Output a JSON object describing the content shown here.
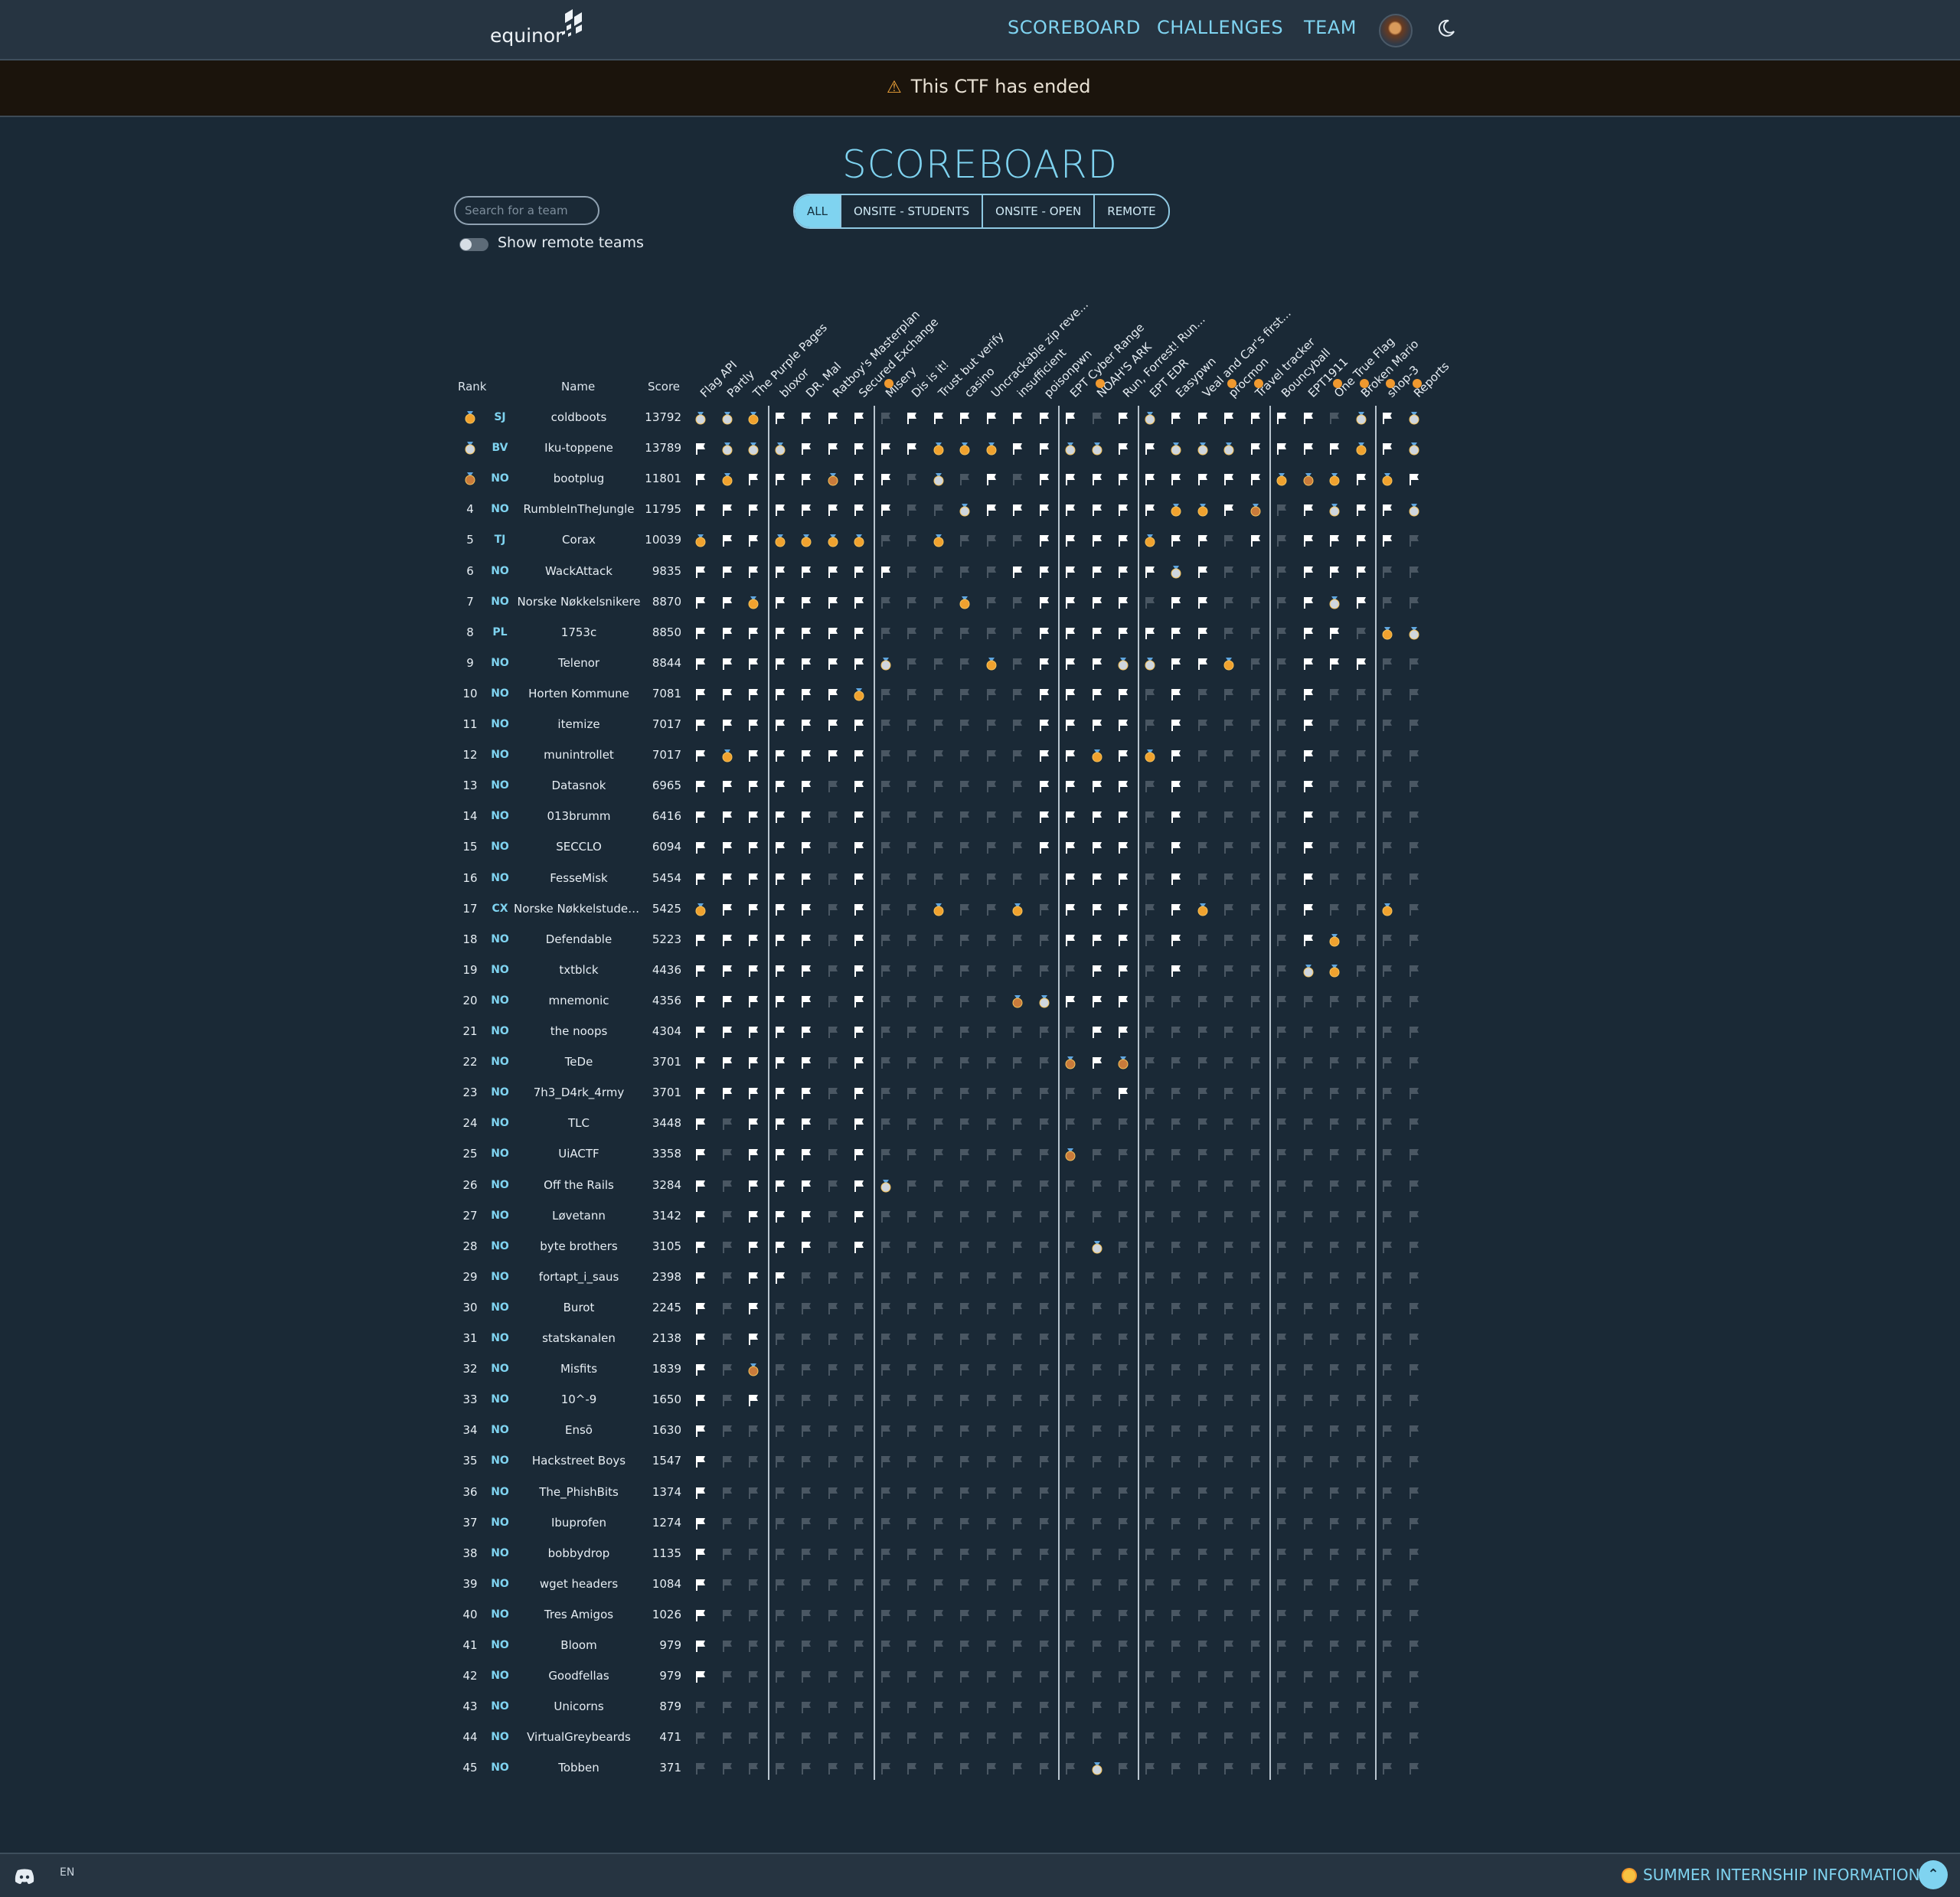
{
  "brand": {
    "name": "equinor"
  },
  "nav": {
    "scoreboard": "SCOREBOARD",
    "challenges": "CHALLENGES",
    "team": "TEAM"
  },
  "banner": {
    "text": "This CTF has ended"
  },
  "page": {
    "title": "SCOREBOARD"
  },
  "search": {
    "placeholder": "Search for a team"
  },
  "toggle": {
    "label": "Show remote teams",
    "on": false
  },
  "filters": [
    "ALL",
    "ONSITE - STUDENTS",
    "ONSITE - OPEN",
    "REMOTE"
  ],
  "active_filter": "ALL",
  "table": {
    "headers": {
      "rank": "Rank",
      "name": "Name",
      "score": "Score"
    },
    "challenges": [
      "Flag API",
      "Partly",
      "The Purple Pages",
      "bloxor",
      "DR. Mal",
      "Ratboy's Masterplan",
      "Secured Exchange",
      "Misery",
      "Dis is it!",
      "Trust but verify",
      "casino",
      "Uncrackable zip reve...",
      "insufficient",
      "poisonpwn",
      "EPT Cyber Range",
      "NOAH'S ARK",
      "Run, Forrest! Run...",
      "EPT EDR",
      "Easypwn",
      "Veal and Car's first...",
      "procmon",
      "Travel tracker",
      "Bouncyball",
      "EPT1911",
      "One True Flag",
      "Broken Mario",
      "shop-3",
      "Reports"
    ],
    "challenge_highlight": [
      false,
      false,
      false,
      false,
      false,
      false,
      false,
      true,
      false,
      false,
      false,
      false,
      false,
      false,
      false,
      true,
      false,
      false,
      false,
      false,
      true,
      true,
      false,
      false,
      true,
      true,
      true,
      true
    ],
    "rows": [
      {
        "rank": "1",
        "medal": "gold",
        "cc": "SJ",
        "name": "coldboots",
        "score": "13792",
        "solves": "ssgzfffnfffffffnfsffffffnsfs"
      },
      {
        "rank": "2",
        "medal": "silver",
        "cc": "BV",
        "name": "Iku-toppene",
        "score": "13789",
        "solves": "fsssfffffgggffssffsssffffgfs"
      },
      {
        "rank": "3",
        "medal": "bronze",
        "cc": "NO",
        "name": "bootplug",
        "score": "11801",
        "solves": "fgfffbfffsnfnfffffffffgbgfgf"
      },
      {
        "rank": "4",
        "cc": "NO",
        "name": "RumbleInTheJungle",
        "score": "11795",
        "solves": "ffffffffffsfffffffggfbffsffs"
      },
      {
        "rank": "5",
        "cc": "TJ",
        "name": "Corax",
        "score": "10039",
        "solves": "gffggggffgfffffffgffffffffff"
      },
      {
        "rank": "6",
        "cc": "NO",
        "name": "WackAttack",
        "score": "9835",
        "solves": "ffffffffffffffffffsfffffffff"
      },
      {
        "rank": "7",
        "cc": "NO",
        "name": "Norske Nøkkelsnikere",
        "score": "8870",
        "solves": "ffgfffffffgfffffffffffffsfff"
      },
      {
        "rank": "8",
        "cc": "PL",
        "name": "1753c",
        "score": "8850",
        "solves": "ffffffffffffffffffffffffffgs"
      },
      {
        "rank": "9",
        "cc": "NO",
        "name": "Telenor",
        "score": "8844",
        "solves": "fffffffsfffgffffssffgfffffff"
      },
      {
        "rank": "10",
        "cc": "NO",
        "name": "Horten Kommune",
        "score": "7081",
        "solves": "ffffffgfffffffffffffffffffff"
      },
      {
        "rank": "11",
        "cc": "NO",
        "name": "itemize",
        "score": "7017",
        "solves": "ffffffffffffffffffffffffffff"
      },
      {
        "rank": "12",
        "cc": "NO",
        "name": "munintrollet",
        "score": "7017",
        "solves": "fgfffffffffffffgfgffffffffff"
      },
      {
        "rank": "13",
        "cc": "NO",
        "name": "Datasnok",
        "score": "6965",
        "solves": "ffffffffffffffffffffffffffff"
      },
      {
        "rank": "14",
        "cc": "NO",
        "name": "013brumm",
        "score": "6416",
        "solves": "ffffffffffffffffffffffffffff"
      },
      {
        "rank": "15",
        "cc": "NO",
        "name": "SECCLO",
        "score": "6094",
        "solves": "ffffffffffffffffffffffffffff"
      },
      {
        "rank": "16",
        "cc": "NO",
        "name": "FesseMisk",
        "score": "5454",
        "solves": "ffffffffffffffffffffffffffff"
      },
      {
        "rank": "17",
        "cc": "CX",
        "name": "Norske Nøkkelstudent...",
        "score": "5425",
        "solves": "gffffffffgffgffffffgffffffgf"
      },
      {
        "rank": "18",
        "cc": "NO",
        "name": "Defendable",
        "score": "5223",
        "solves": "ffffffffffffffffffffffffgfff"
      },
      {
        "rank": "19",
        "cc": "NO",
        "name": "txtblck",
        "score": "4436",
        "solves": "fffffffffffffffffffffffsgfff"
      },
      {
        "rank": "20",
        "cc": "NO",
        "name": "mnemonic",
        "score": "4356",
        "solves": "ffffffffffffbsffffffffffffff"
      },
      {
        "rank": "21",
        "cc": "NO",
        "name": "the noops",
        "score": "4304",
        "solves": "ffffffffffffffffffffffffffff"
      },
      {
        "rank": "22",
        "cc": "NO",
        "name": "TeDe",
        "score": "3701",
        "solves": "ffffffffffffffbfbfffffffffff"
      },
      {
        "rank": "23",
        "cc": "NO",
        "name": "7h3_D4rk_4rmy",
        "score": "3701",
        "solves": "ffffffffffffffffffffffffffff"
      },
      {
        "rank": "24",
        "cc": "NO",
        "name": "TLC",
        "score": "3448",
        "solves": "ffffffffffffffffffffffffffff"
      },
      {
        "rank": "25",
        "cc": "NO",
        "name": "UiACTF",
        "score": "3358",
        "solves": "ffffffffffffffbfffffffffffff"
      },
      {
        "rank": "26",
        "cc": "NO",
        "name": "Off the Rails",
        "score": "3284",
        "solves": "fffffffsffffffffffffffffffff"
      },
      {
        "rank": "27",
        "cc": "NO",
        "name": "Løvetann",
        "score": "3142",
        "solves": "ffffffffffffffffffffffffffff"
      },
      {
        "rank": "28",
        "cc": "NO",
        "name": "byte brothers",
        "score": "3105",
        "solves": "fffffffffffffffsffffffffffff"
      },
      {
        "rank": "29",
        "cc": "NO",
        "name": "fortapt_i_saus",
        "score": "2398",
        "solves": "ffffffffffffffffffffffffffff"
      },
      {
        "rank": "30",
        "cc": "NO",
        "name": "Burot",
        "score": "2245",
        "solves": "ffffffffffffffffffffffffffff"
      },
      {
        "rank": "31",
        "cc": "NO",
        "name": "statskanalen",
        "score": "2138",
        "solves": "ffffffffffffffffffffffffffff"
      },
      {
        "rank": "32",
        "cc": "NO",
        "name": "Misfits",
        "score": "1839",
        "solves": "ffbfffffffffffffffffffffffff"
      },
      {
        "rank": "33",
        "cc": "NO",
        "name": "10^-9",
        "score": "1650",
        "solves": "ffffffffffffffffffffffffffff"
      },
      {
        "rank": "34",
        "cc": "NO",
        "name": "Ensō",
        "score": "1630",
        "solves": "ffffffffffffffffffffffffffff"
      },
      {
        "rank": "35",
        "cc": "NO",
        "name": "Hackstreet Boys",
        "score": "1547",
        "solves": "ffffffffffffffffffffffffffff"
      },
      {
        "rank": "36",
        "cc": "NO",
        "name": "The_PhishBits",
        "score": "1374",
        "solves": "ffffffffffffffffffffffffffff"
      },
      {
        "rank": "37",
        "cc": "NO",
        "name": "Ibuprofen",
        "score": "1274",
        "solves": "ffffffffffffffffffffffffffff"
      },
      {
        "rank": "38",
        "cc": "NO",
        "name": "bobbydrop",
        "score": "1135",
        "solves": "ffffffffffffffffffffffffffff"
      },
      {
        "rank": "39",
        "cc": "NO",
        "name": "wget headers",
        "score": "1084",
        "solves": "ffffffffffffffffffffffffffff"
      },
      {
        "rank": "40",
        "cc": "NO",
        "name": "Tres Amigos",
        "score": "1026",
        "solves": "ffffffffffffffffffffffffffff"
      },
      {
        "rank": "41",
        "cc": "NO",
        "name": "Bloom",
        "score": "979",
        "solves": "ffffffffffffffffffffffffffff"
      },
      {
        "rank": "42",
        "cc": "NO",
        "name": "Goodfellas",
        "score": "979",
        "solves": "ffffffffffffffffffffffffffff"
      },
      {
        "rank": "43",
        "cc": "NO",
        "name": "Unicorns",
        "score": "879",
        "solves": "ffffffffffffffffffffffffffff"
      },
      {
        "rank": "44",
        "cc": "NO",
        "name": "VirtualGreybeards",
        "score": "471",
        "solves": "ffffffffffffffffffffffffffff"
      },
      {
        "rank": "45",
        "cc": "NO",
        "name": "Tobben",
        "score": "371",
        "solves": "fffffffffffffffsffffffffffff"
      }
    ],
    "solved_masks": [
      "1111111111111111111111111111",
      "1111111111111111111111111111",
      "1111111111111111111111111111",
      "1111111111111111111111111111",
      "1011111111111111111111111111",
      "1011101011111111111111111111",
      "1011101011111111111111111111",
      "1111111111111111111111111111",
      "1011111011111111111111111111",
      "1011111111111111111111111111",
      "1111111111111111111111111111",
      "1111111111111111111111111111",
      "1011111111111111111111111111",
      "1010001000011111111111111111",
      "1111111111111111111111111111",
      "1011000011111111111111111111",
      "1111111111111111111111111111",
      "1011111111111111111111111111",
      "1001111111111111111111111111",
      "1111111111111111111111111111",
      "1011111111111111111111111111",
      "1011111111111111111111111111",
      "1111111111111111111111111111",
      "1011111111111111111111111111",
      "1110011111111111111111111111",
      "1011111111111111111111111111",
      "1011001111111111111111111111",
      "1011111111111111111111111111",
      "1011111111111111111111111111",
      "1011001011111111111111111111",
      "1011001011111111111111111111",
      "1011111111111111111111111111",
      "0110000011111111111111111111",
      "1001001011111111111111111111",
      "1011001011111111111111111111",
      "0011001011111111111111111111",
      "0011001011111111111111111111",
      "1111001011111111111111111111",
      "1001001011111111111111111111",
      "0000111111111111111111111111",
      "0010001011111111111111111111",
      "0010001011111111111111111111",
      "0010001011111111111111111111",
      "0010001011111111111111111111",
      "0010001111111111111111111111"
    ]
  },
  "footer": {
    "lang": "EN",
    "summer": "SUMMER INTERNSHIP INFORMATION"
  },
  "colors": {
    "accent": "#7fd3f0",
    "bg": "#1a2936",
    "gold": "#f0992f",
    "flag": "#ffffff",
    "unsolved": "#4a5763"
  }
}
